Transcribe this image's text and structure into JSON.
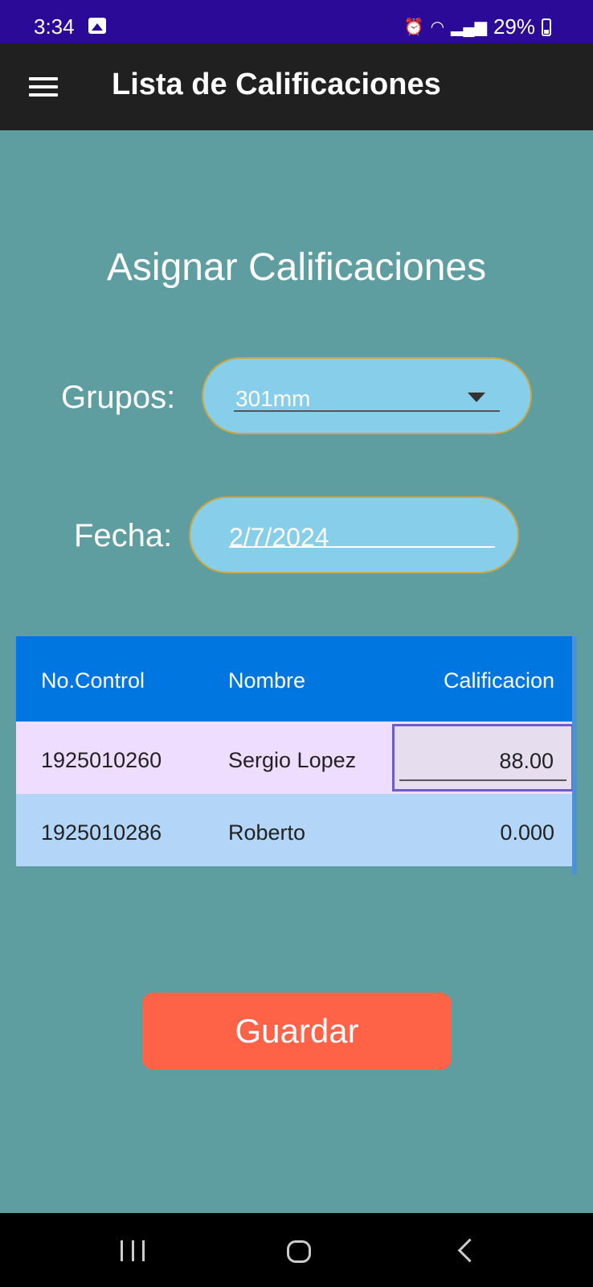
{
  "status_bar": {
    "time": "3:34",
    "battery": "29%",
    "icons": [
      "photo-icon",
      "alarm-icon",
      "wifi-icon",
      "signal-icon",
      "battery-icon"
    ]
  },
  "app_bar": {
    "title": "Lista de Calificaciones",
    "menu_icon": "menu-icon"
  },
  "page": {
    "title": "Asignar Calificaciones",
    "grupos": {
      "label": "Grupos:",
      "value": "301mm"
    },
    "fecha": {
      "label": "Fecha:",
      "value": "2/7/2024"
    }
  },
  "table": {
    "headers": [
      "No.Control",
      "Nombre",
      "Calificacion"
    ],
    "rows": [
      {
        "control": "1925010260",
        "nombre": "Sergio Lopez",
        "calificacion": "88.00"
      },
      {
        "control": "1925010286",
        "nombre": "Roberto",
        "calificacion": "0.000"
      }
    ]
  },
  "actions": {
    "save_label": "Guardar"
  },
  "colors": {
    "background": "#5F9EA0",
    "status_bar": "#2A0A96",
    "app_bar": "#202020",
    "table_header": "#0076E0",
    "save_button": "#FF6347",
    "input_fill": "#87CEEB"
  }
}
